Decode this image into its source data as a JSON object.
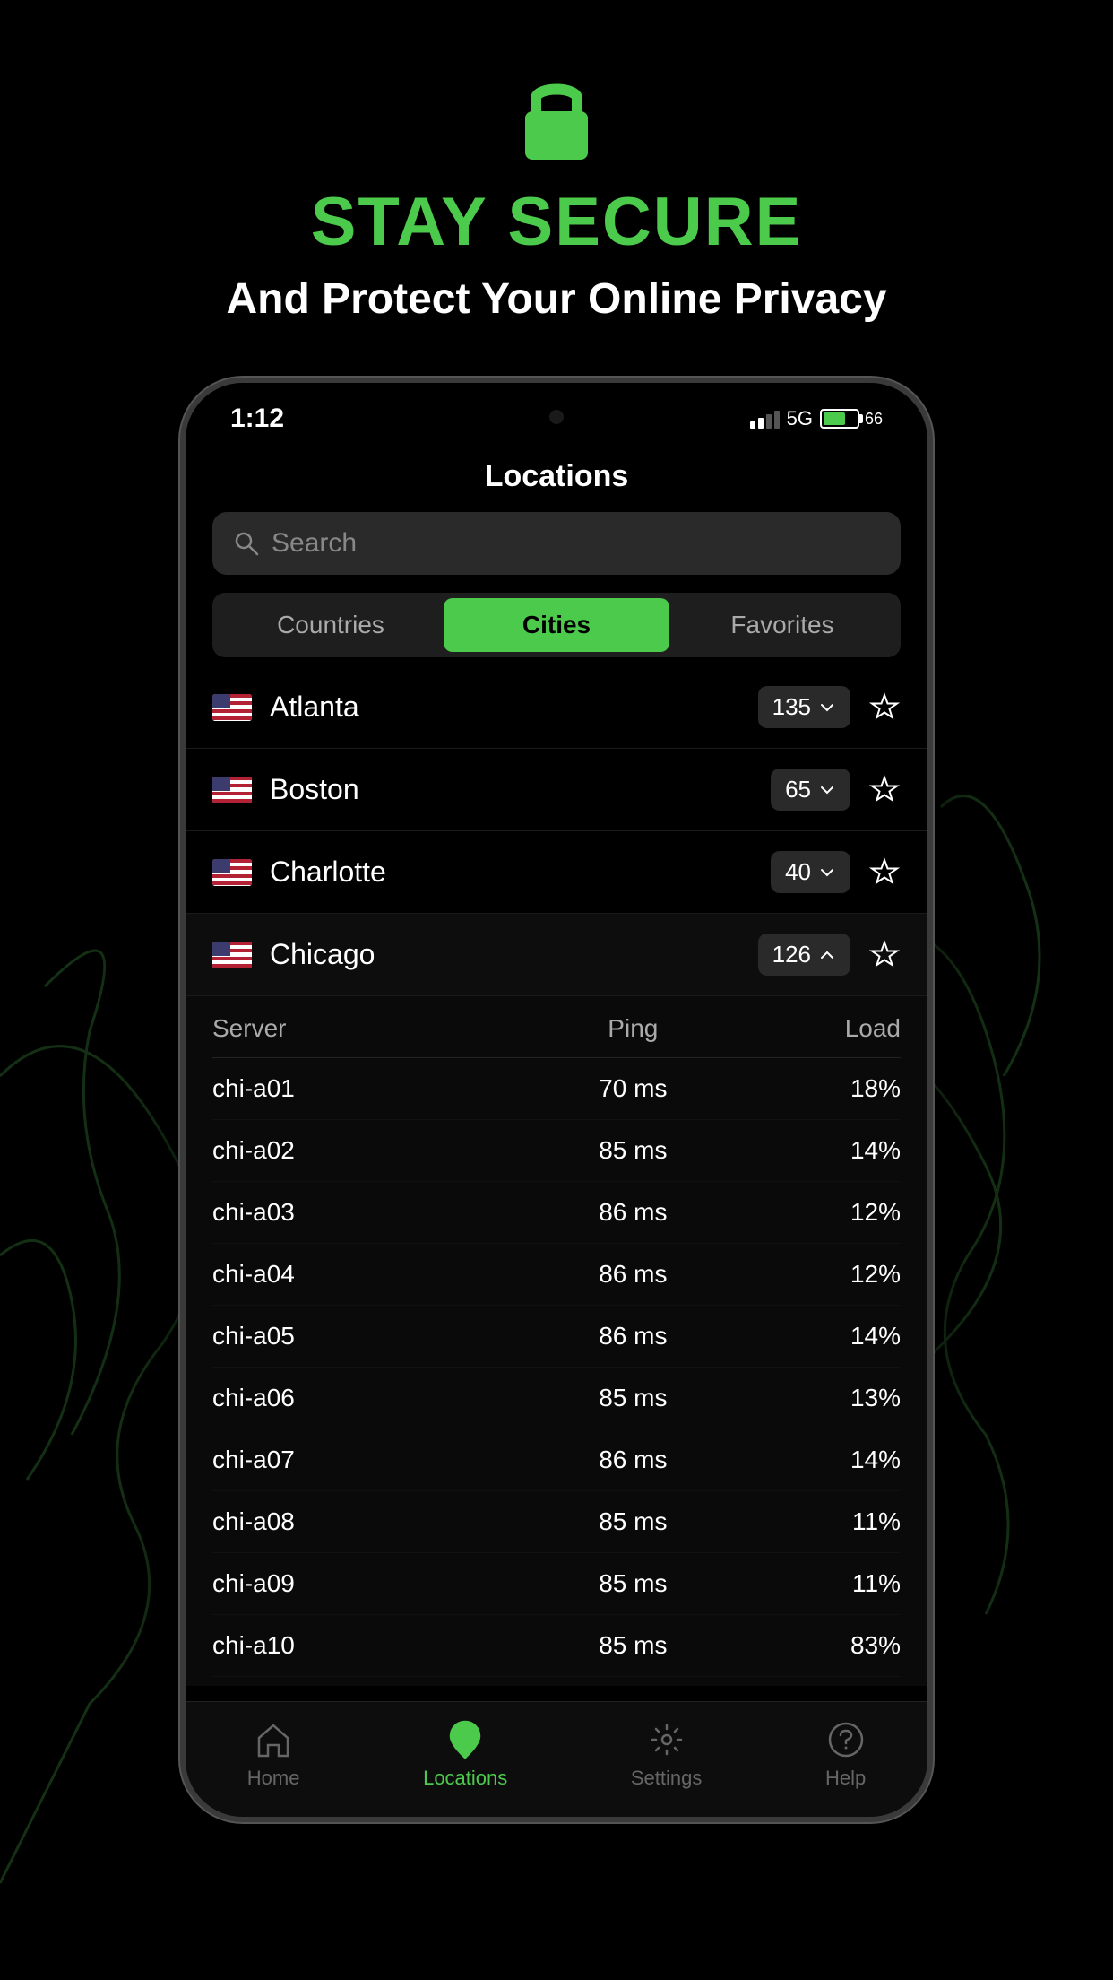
{
  "background": {
    "color": "#000000"
  },
  "header": {
    "lock_icon_label": "lock-icon",
    "headline": "STAY SECURE",
    "subheadline": "And Protect Your Online Privacy"
  },
  "phone": {
    "status_bar": {
      "time": "1:12",
      "network": "5G",
      "battery_level": "66",
      "battery_label": "66"
    },
    "screen_title": "Locations",
    "search": {
      "placeholder": "Search"
    },
    "tabs": [
      {
        "id": "countries",
        "label": "Countries",
        "active": false
      },
      {
        "id": "cities",
        "label": "Cities",
        "active": true
      },
      {
        "id": "favorites",
        "label": "Favorites",
        "active": false
      }
    ],
    "cities": [
      {
        "name": "Atlanta",
        "server_count": 135,
        "expanded": false,
        "country": "US"
      },
      {
        "name": "Boston",
        "server_count": 65,
        "expanded": false,
        "country": "US"
      },
      {
        "name": "Charlotte",
        "server_count": 40,
        "expanded": false,
        "country": "US"
      },
      {
        "name": "Chicago",
        "server_count": 126,
        "expanded": true,
        "country": "US"
      }
    ],
    "server_table": {
      "headers": {
        "server": "Server",
        "ping": "Ping",
        "load": "Load"
      },
      "rows": [
        {
          "name": "chi-a01",
          "ping": "70 ms",
          "load": "18%"
        },
        {
          "name": "chi-a02",
          "ping": "85 ms",
          "load": "14%"
        },
        {
          "name": "chi-a03",
          "ping": "86 ms",
          "load": "12%"
        },
        {
          "name": "chi-a04",
          "ping": "86 ms",
          "load": "12%"
        },
        {
          "name": "chi-a05",
          "ping": "86 ms",
          "load": "14%"
        },
        {
          "name": "chi-a06",
          "ping": "85 ms",
          "load": "13%"
        },
        {
          "name": "chi-a07",
          "ping": "86 ms",
          "load": "14%"
        },
        {
          "name": "chi-a08",
          "ping": "85 ms",
          "load": "11%"
        },
        {
          "name": "chi-a09",
          "ping": "85 ms",
          "load": "11%"
        },
        {
          "name": "chi-a10",
          "ping": "85 ms",
          "load": "83%"
        }
      ]
    },
    "bottom_nav": [
      {
        "id": "home",
        "label": "Home",
        "active": false
      },
      {
        "id": "locations",
        "label": "Locations",
        "active": true
      },
      {
        "id": "settings",
        "label": "Settings",
        "active": false
      },
      {
        "id": "help",
        "label": "Help",
        "active": false
      }
    ]
  },
  "colors": {
    "accent": "#4cca4c",
    "background": "#000000",
    "surface": "#1a1a1a",
    "text_primary": "#ffffff",
    "text_secondary": "#aaaaaa"
  }
}
